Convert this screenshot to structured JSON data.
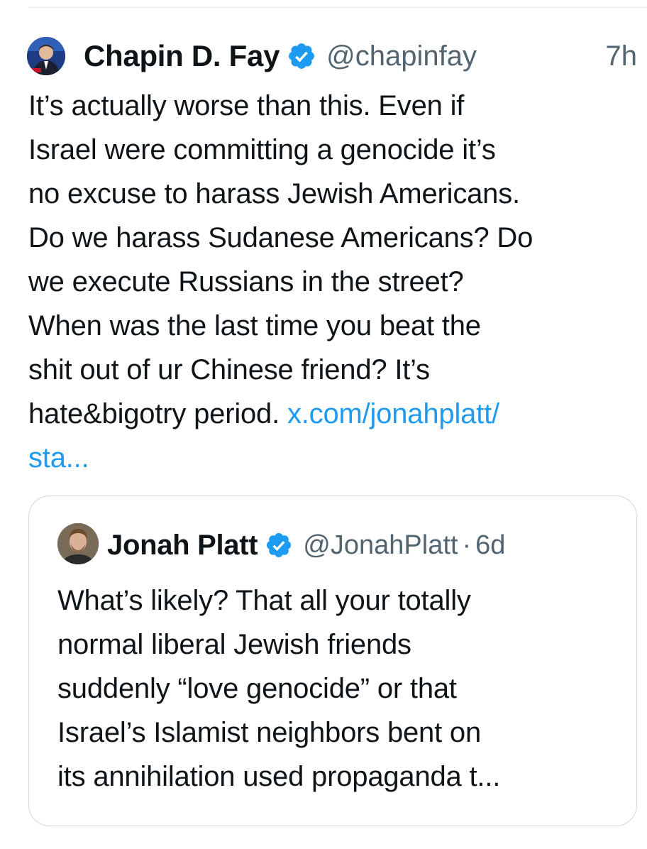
{
  "tweet": {
    "author": {
      "display_name": "Chapin D. Fay",
      "handle": "@chapinfay",
      "verified": true,
      "avatar_icon": "profile-photo"
    },
    "time": "7h",
    "text_lines": [
      "It’s actually worse than this. Even if",
      "Israel were committing a genocide it’s",
      "no excuse to harass Jewish Americans.",
      "Do we harass Sudanese Americans? Do",
      "we execute Russians in the street?",
      "When was the last time you beat the",
      "shit out of ur Chinese friend? It’s"
    ],
    "last_line_text": "hate&bigotry period.",
    "link_line_1": "x.com/jonahplatt/",
    "link_line_2": "sta..."
  },
  "quoted_tweet": {
    "author": {
      "display_name": "Jonah Platt",
      "handle": "@JonahPlatt",
      "verified": true,
      "avatar_icon": "profile-photo"
    },
    "separator": "·",
    "time": "6d",
    "text_lines": [
      "What’s likely? That all your totally",
      "normal liberal Jewish friends",
      "suddenly “love genocide” or that",
      "Israel’s Islamist neighbors bent on",
      "its annihilation used propaganda t..."
    ]
  },
  "colors": {
    "text": "#0f1419",
    "secondary": "#536471",
    "link": "#1d9bf0",
    "verified_badge": "#1d9bf0",
    "border": "#cfd9de"
  }
}
